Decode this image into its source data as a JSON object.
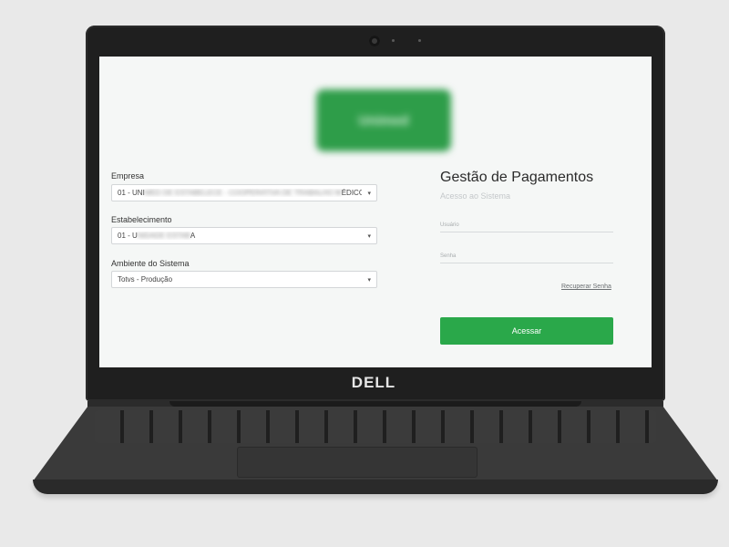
{
  "brand": "DELL",
  "logo": {
    "text": "Unimed"
  },
  "form_left": {
    "empresa": {
      "label": "Empresa",
      "prefix": "01 - UNI",
      "hidden": "MED DE ESTABELECE - COOPERATIVA DE TRABALHO M",
      "suffix": "ÉDICO"
    },
    "estabelecimento": {
      "label": "Estabelecimento",
      "prefix": "01 - U",
      "hidden": "NIDADE ESTAB",
      "suffix": "A"
    },
    "ambiente": {
      "label": "Ambiente do Sistema",
      "value": "Totvs - Produção"
    }
  },
  "form_right": {
    "title": "Gestão de Pagamentos",
    "subtitle": "Acesso ao Sistema",
    "usuario_placeholder": "Usuário",
    "senha_placeholder": "Senha",
    "recover_link": "Recuperar Senha",
    "submit_label": "Acessar"
  },
  "colors": {
    "accent": "#2aa84a",
    "logo_bg": "#2e9d49",
    "screen_bg": "#f5f7f6",
    "laptop": "#1f1f1f"
  }
}
